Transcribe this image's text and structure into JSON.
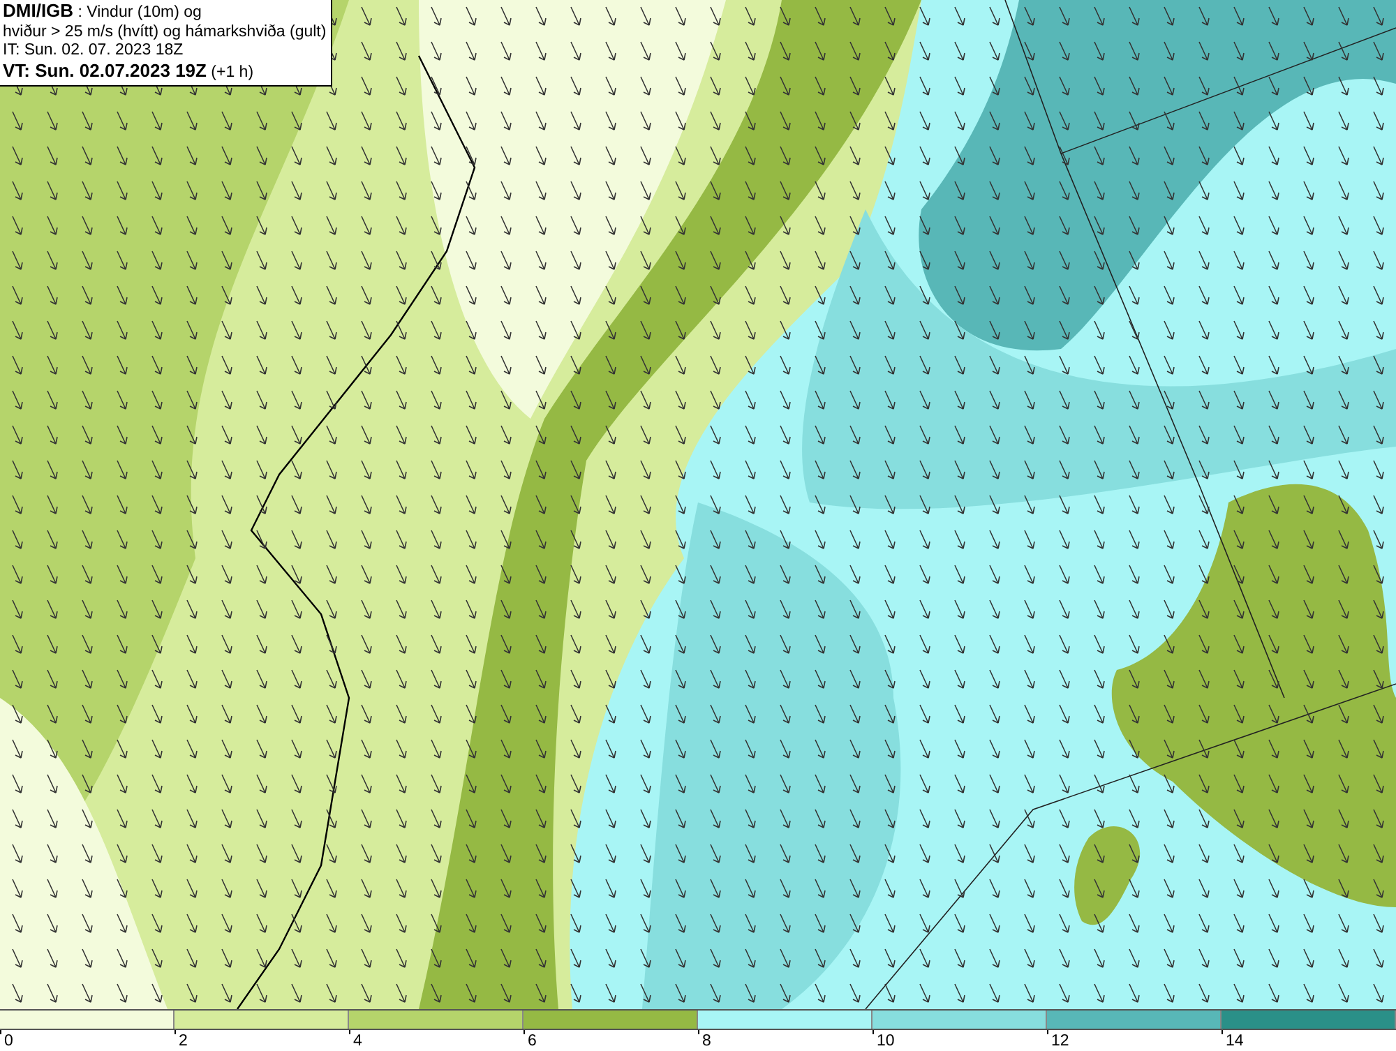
{
  "header": {
    "lines": [
      "**DMI/IGB** : Vindur (10m) og",
      "hviður > 25 m/s (hvítt) og hámarkshviða (gult)",
      "IT: Sun. 02. 07. 2023 18Z",
      "**VT: Sun. 02.07.2023 19Z** (+1 h)"
    ]
  },
  "legend": {
    "bins": [
      {
        "color": "#f3fbdc"
      },
      {
        "color": "#d6ec9c"
      },
      {
        "color": "#b5d46b"
      },
      {
        "color": "#95b944"
      },
      {
        "color": "#a8f5f5"
      },
      {
        "color": "#87dede"
      },
      {
        "color": "#58b7b7"
      },
      {
        "color": "#2a9088"
      }
    ],
    "ticks": [
      "0",
      "2",
      "4",
      "6",
      "8",
      "10",
      "12",
      "14"
    ]
  }
}
